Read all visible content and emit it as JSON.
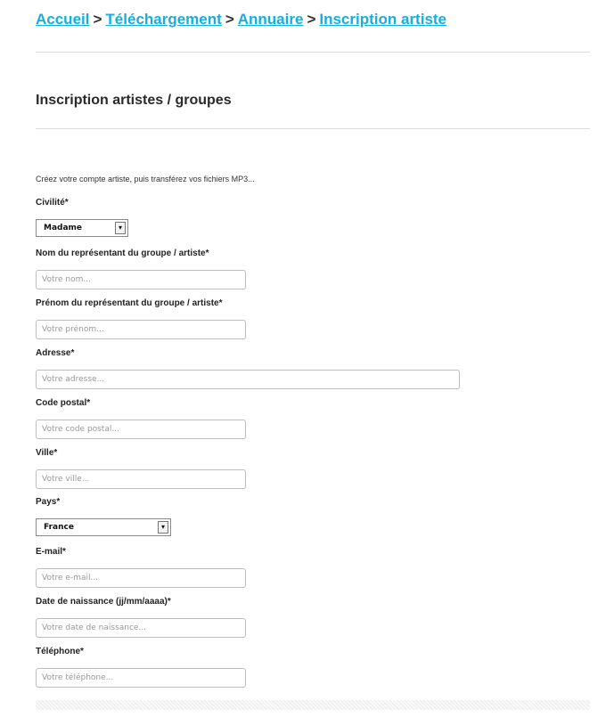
{
  "breadcrumb": {
    "items": [
      "Accueil",
      "Téléchargement",
      "Annuaire",
      "Inscription artiste"
    ],
    "separator": ">"
  },
  "page": {
    "title": "Inscription artistes / groupes",
    "intro": "Créez votre compte artiste, puis transférez vos fichiers MP3..."
  },
  "form": {
    "civilite": {
      "label": "Civilité*",
      "value": "Madame"
    },
    "nom": {
      "label": "Nom du représentant du groupe / artiste*",
      "placeholder": "Votre nom..."
    },
    "prenom": {
      "label": "Prénom du représentant du groupe / artiste*",
      "placeholder": "Votre prénom..."
    },
    "adresse": {
      "label": "Adresse*",
      "placeholder": "Votre adresse..."
    },
    "code_postal": {
      "label": "Code postal*",
      "placeholder": "Votre code postal..."
    },
    "ville": {
      "label": "Ville*",
      "placeholder": "Votre ville..."
    },
    "pays": {
      "label": "Pays*",
      "value": "France"
    },
    "email": {
      "label": "E-mail*",
      "placeholder": "Votre e-mail..."
    },
    "naissance": {
      "label": "Date de naissance (jj/mm/aaaa)*",
      "placeholder": "Votre date de naissance..."
    },
    "telephone": {
      "label": "Téléphone*",
      "placeholder": "Votre téléphone..."
    }
  },
  "colors": {
    "link": "#15aee0",
    "rule": "#dcdcdc"
  }
}
